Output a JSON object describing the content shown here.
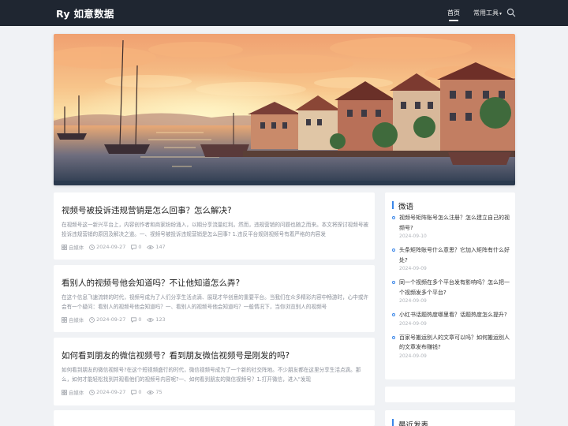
{
  "header": {
    "logo": "Ry 如意数据",
    "nav": {
      "home": "首页",
      "tools": "常用工具"
    }
  },
  "articles": [
    {
      "title": "视频号被投诉违规营销是怎么回事？怎么解决?",
      "excerpt": "在视频号这一新兴平台上，内容创作者和商家纷纷涌入，以期分享流量红利。然而，违规营销的问题也随之而来。本文将探讨视频号被投诉违规营销的原因及解决之道。一、视频号被投诉违规营销是怎么回事? 1.违反平台规则视频号有着严格的内容发",
      "author": "自媒体",
      "date": "2024-09-27",
      "comments": "0",
      "views": "147"
    },
    {
      "title": "看别人的视频号他会知道吗？不让他知道怎么弄?",
      "excerpt": "在这个信息飞速流转的时代，视频号成为了人们分享生活点滴、展现才华创意的重要平台。当我们在众多精彩内容中畅游时，心中或许会有一个疑问：看别人的视频号他会知道吗？一、看别人的视频号他会知道吗？一般情况下，当你浏览别人的视频号",
      "author": "自媒体",
      "date": "2024-09-27",
      "comments": "0",
      "views": "123"
    },
    {
      "title": "如何看到朋友的微信视频号？看到朋友微信视频号是刚发的吗?",
      "excerpt": "如何看到朋友的微信视频号?在这个短视频盛行的时代，微信视频号成为了一个新的社交阵地。不少朋友都在这里分享生活点滴。那么，如何才能轻松找到并观看他们的视频号内容呢?一、如何看到朋友的微信视频号？1.打开微信，进入\"发现",
      "author": "自媒体",
      "date": "2024-09-27",
      "comments": "0",
      "views": "75"
    }
  ],
  "sidebar": {
    "weiyu": {
      "title": "微语",
      "items": [
        {
          "text": "视频号矩阵账号怎么注册？怎么建立自己的视频号?",
          "date": "2024-09-10"
        },
        {
          "text": "头条矩阵账号什么意思？它加入矩阵有什么好处?",
          "date": "2024-09-09"
        },
        {
          "text": "同一个视频在多个平台发有影响吗？怎么把一个视频发多个平台?",
          "date": "2024-09-09"
        },
        {
          "text": "小红书话题热度哪里看？话题热度怎么提升?",
          "date": "2024-09-09"
        },
        {
          "text": "百家号搬运别人的文章可以吗？如何搬运别人的文章发布赚钱?",
          "date": "2024-09-09"
        }
      ]
    },
    "recent": {
      "title": "最近发表"
    }
  },
  "colors": {
    "header_bg": "#1f2631",
    "accent": "#3a86e8",
    "page_bg": "#f0f2f5"
  }
}
